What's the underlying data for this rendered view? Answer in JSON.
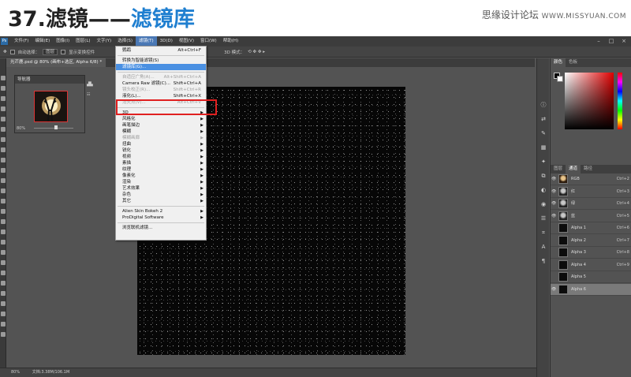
{
  "slide": {
    "number": "37.",
    "title_main": "滤镜——",
    "title_accent": "滤镜库",
    "watermark_cn": "思缘设计论坛",
    "watermark_en": "WWW.MISSYUAN.COM"
  },
  "colors": {
    "accent": "#1f7fd0",
    "highlight": "#e02020",
    "menu_highlight": "#4a90e2"
  },
  "ps": {
    "logo": "Ps",
    "menus": [
      "文件(F)",
      "编辑(E)",
      "图像(I)",
      "图层(L)",
      "文字(Y)",
      "选择(S)",
      "滤镜(T)",
      "3D(D)",
      "视图(V)",
      "窗口(W)",
      "帮助(H)"
    ],
    "active_menu": "滤镜(T)",
    "window_controls": {
      "minimize": "–",
      "maximize": "□",
      "close": "×"
    },
    "options": {
      "auto_select_label": "自动选择：",
      "auto_select_value": "图层",
      "show_transform_label": "显示变换控件",
      "mode_3d_label": "3D 模式："
    },
    "doc_tab": "光芒鹿.psd @ 80% (画布+选区, Alpha 6/8) *",
    "navigator": {
      "title": "导航器",
      "zoom": "80%"
    },
    "side_labels": [
      "",
      ""
    ],
    "status": {
      "zoom": "80%",
      "doc_info": "文档:3.38M/106.1M"
    },
    "filter_menu": {
      "items": [
        {
          "label": "鹦鹉",
          "shortcut": "Alt+Ctrl+F",
          "state": "normal"
        },
        {
          "label": "转换为智能滤镜(S)",
          "shortcut": "",
          "state": "normal"
        },
        {
          "label": "滤镜库(G)...",
          "shortcut": "",
          "state": "highlight"
        },
        {
          "label": "自适应广角(A)...",
          "shortcut": "Alt+Shift+Ctrl+A",
          "state": "disabled"
        },
        {
          "label": "Camera Raw 滤镜(C)...",
          "shortcut": "Shift+Ctrl+A",
          "state": "normal"
        },
        {
          "label": "镜头校正(R)...",
          "shortcut": "Shift+Ctrl+R",
          "state": "disabled"
        },
        {
          "label": "液化(L)...",
          "shortcut": "Shift+Ctrl+X",
          "state": "normal"
        },
        {
          "label": "消失点(V)...",
          "shortcut": "Alt+Ctrl+V",
          "state": "disabled"
        }
      ],
      "submenus": [
        "3D",
        "风格化",
        "画笔描边",
        "模糊",
        "模糊画廊",
        "扭曲",
        "锐化",
        "视频",
        "素描",
        "纹理",
        "像素化",
        "渲染",
        "艺术效果",
        "杂色",
        "其它"
      ],
      "plugins": [
        "Alien Skin Bokeh 2",
        "ProDigital Software"
      ],
      "browse": "浏览联机滤镜..."
    },
    "color_panel": {
      "tabs": [
        "颜色",
        "色板"
      ]
    },
    "channels_panel": {
      "tabs": [
        "图层",
        "通道",
        "路径"
      ],
      "rows": [
        {
          "name": "RGB",
          "shortcut": "Ctrl+2",
          "thumb": "rgb"
        },
        {
          "name": "红",
          "shortcut": "Ctrl+3",
          "thumb": "lit"
        },
        {
          "name": "绿",
          "shortcut": "Ctrl+4",
          "thumb": "lit"
        },
        {
          "name": "蓝",
          "shortcut": "Ctrl+5",
          "thumb": "lit"
        },
        {
          "name": "Alpha 1",
          "shortcut": "Ctrl+6",
          "thumb": "dark"
        },
        {
          "name": "Alpha 2",
          "shortcut": "Ctrl+7",
          "thumb": "dark"
        },
        {
          "name": "Alpha 3",
          "shortcut": "Ctrl+8",
          "thumb": "dark"
        },
        {
          "name": "Alpha 4",
          "shortcut": "Ctrl+9",
          "thumb": "dark"
        },
        {
          "name": "Alpha 5",
          "shortcut": "",
          "thumb": "dark"
        },
        {
          "name": "Alpha 6",
          "shortcut": "",
          "thumb": "dark",
          "selected": true
        }
      ]
    }
  }
}
